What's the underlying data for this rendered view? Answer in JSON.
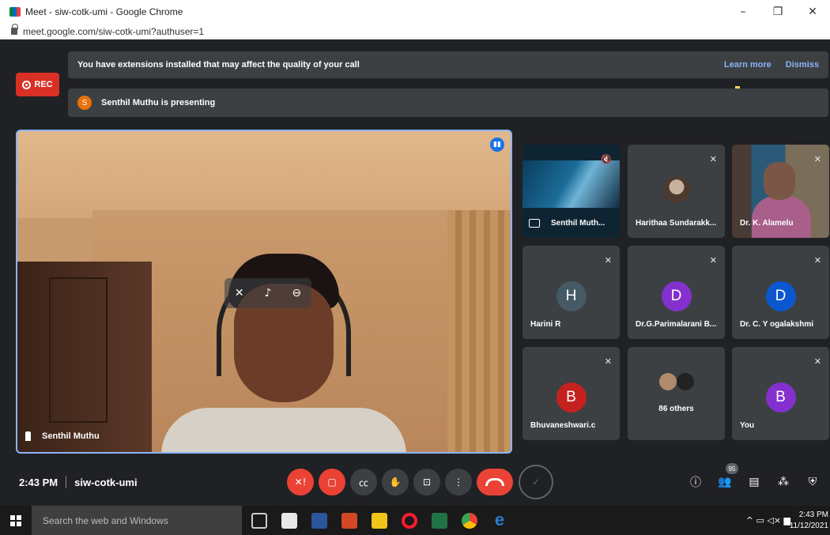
{
  "browser": {
    "window_title": "Meet - siw-cotk-umi - Google Chrome",
    "url": "meet.google.com/siw-cotk-umi?authuser=1",
    "controls": {
      "minimize": "–",
      "restore": "❐",
      "close": "✕"
    }
  },
  "recording": {
    "label": "REC",
    "color": "#d93025"
  },
  "extension_banner": {
    "message": "You have extensions installed that may affect the quality of your call",
    "learn_more": "Learn more",
    "dismiss": "Dismiss"
  },
  "presenting_banner": {
    "avatar_letter": "S",
    "message": "Senthil Muthu is presenting"
  },
  "main_video": {
    "name": "Senthil Muthu"
  },
  "participants": [
    {
      "name": "Senthil Muth...",
      "type": "screen"
    },
    {
      "name": "Harithaa Sundarakk...",
      "type": "photo"
    },
    {
      "name": "Dr. K. Alamelu",
      "type": "video"
    },
    {
      "name": "Harini R",
      "letter": "H",
      "color": "#455a64"
    },
    {
      "name": "Dr.G.Parimalarani B...",
      "letter": "D",
      "color": "#8430ce"
    },
    {
      "name": "Dr. C. Y ogalakshmi",
      "letter": "D",
      "color": "#0b57d0"
    },
    {
      "name": "Bhuvaneshwari.c",
      "letter": "B",
      "color": "#c5221f"
    },
    {
      "name": "86 others",
      "type": "others"
    },
    {
      "name": "You",
      "letter": "B",
      "color": "#8430ce"
    }
  ],
  "bottom_bar": {
    "time": "2:43 PM",
    "meeting_code": "siw-cotk-umi",
    "participant_count": "95"
  },
  "taskbar": {
    "search_placeholder": "Search the web and Windows",
    "clock_time": "2:43 PM",
    "clock_date": "11/12/2021"
  }
}
